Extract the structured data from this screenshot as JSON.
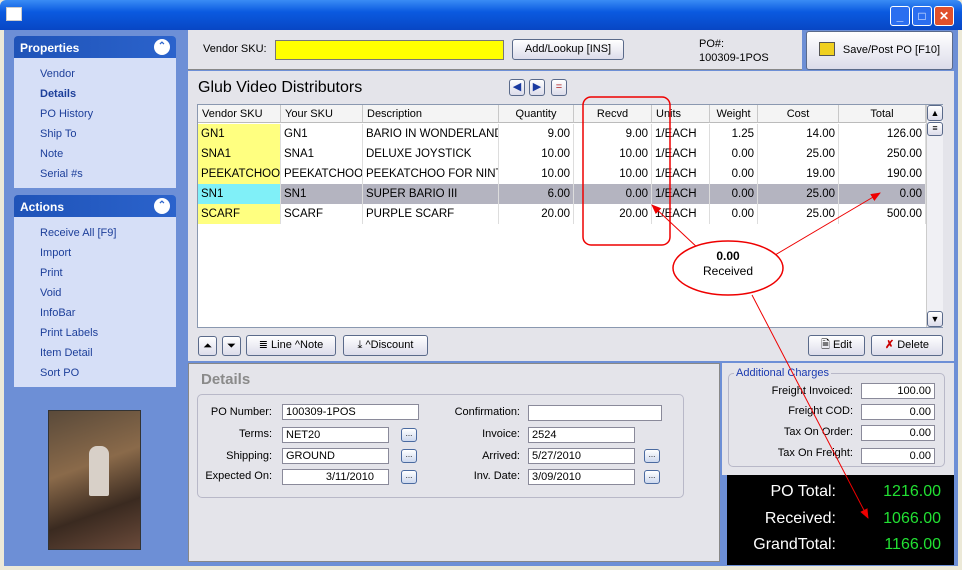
{
  "sidebar": {
    "properties": {
      "title": "Properties",
      "items": [
        "Vendor",
        "Details",
        "PO History",
        "Ship To",
        "Note",
        "Serial #s"
      ]
    },
    "actions": {
      "title": "Actions",
      "items": [
        "Receive All [F9]",
        "Import",
        "Print",
        "Void",
        "InfoBar",
        "Print Labels",
        "Item Detail",
        "Sort PO"
      ]
    }
  },
  "toolbar": {
    "vendor_sku_label": "Vendor SKU:",
    "vendor_sku_value": "",
    "add_lookup": "Add/Lookup [INS]",
    "po_label": "PO#:",
    "po_value": "100309-1POS",
    "save_post": "Save/Post PO [F10]"
  },
  "grid": {
    "vendor_name": "Glub Video Distributors",
    "columns": [
      "Vendor SKU",
      "Your SKU",
      "Description",
      "Quantity",
      "Recvd",
      "Units",
      "Weight",
      "Cost",
      "Total"
    ],
    "rows": [
      [
        "GN1",
        "GN1",
        "BARIO IN WONDERLAND",
        "9.00",
        "9.00",
        "1/EACH",
        "1.25",
        "14.00",
        "126.00"
      ],
      [
        "SNA1",
        "SNA1",
        "DELUXE JOYSTICK",
        "10.00",
        "10.00",
        "1/EACH",
        "0.00",
        "25.00",
        "250.00"
      ],
      [
        "PEEKATCHOO",
        "PEEKATCHOO",
        "PEEKATCHOO FOR NINTE",
        "10.00",
        "10.00",
        "1/EACH",
        "0.00",
        "19.00",
        "190.00"
      ],
      [
        "SN1",
        "SN1",
        "SUPER BARIO III",
        "6.00",
        "0.00",
        "1/EACH",
        "0.00",
        "25.00",
        "0.00"
      ],
      [
        "SCARF",
        "SCARF",
        "PURPLE SCARF",
        "20.00",
        "20.00",
        "1/EACH",
        "0.00",
        "25.00",
        "500.00"
      ]
    ],
    "selected_row": 3,
    "line_note": "Line ^Note",
    "discount": "^Discount",
    "edit": "Edit",
    "delete": "Delete"
  },
  "annotation": {
    "line1": "0.00",
    "line2": "Received"
  },
  "details": {
    "title": "Details",
    "po_number_label": "PO Number:",
    "po_number": "100309-1POS",
    "terms_label": "Terms:",
    "terms": "NET20",
    "shipping_label": "Shipping:",
    "shipping": "GROUND",
    "expected_label": "Expected On:",
    "expected": "3/11/2010",
    "confirmation_label": "Confirmation:",
    "confirmation": "",
    "invoice_label": "Invoice:",
    "invoice": "2524",
    "arrived_label": "Arrived:",
    "arrived": "5/27/2010",
    "inv_date_label": "Inv. Date:",
    "inv_date": "3/09/2010"
  },
  "charges": {
    "title": "Additional Charges",
    "freight_invoiced_label": "Freight Invoiced:",
    "freight_invoiced": "100.00",
    "freight_cod_label": "Freight COD:",
    "freight_cod": "0.00",
    "tax_order_label": "Tax On Order:",
    "tax_order": "0.00",
    "tax_freight_label": "Tax On Freight:",
    "tax_freight": "0.00"
  },
  "totals": {
    "po_total_label": "PO Total:",
    "po_total": "1216.00",
    "received_label": "Received:",
    "received": "1066.00",
    "grand_label": "GrandTotal:",
    "grand": "1166.00"
  }
}
